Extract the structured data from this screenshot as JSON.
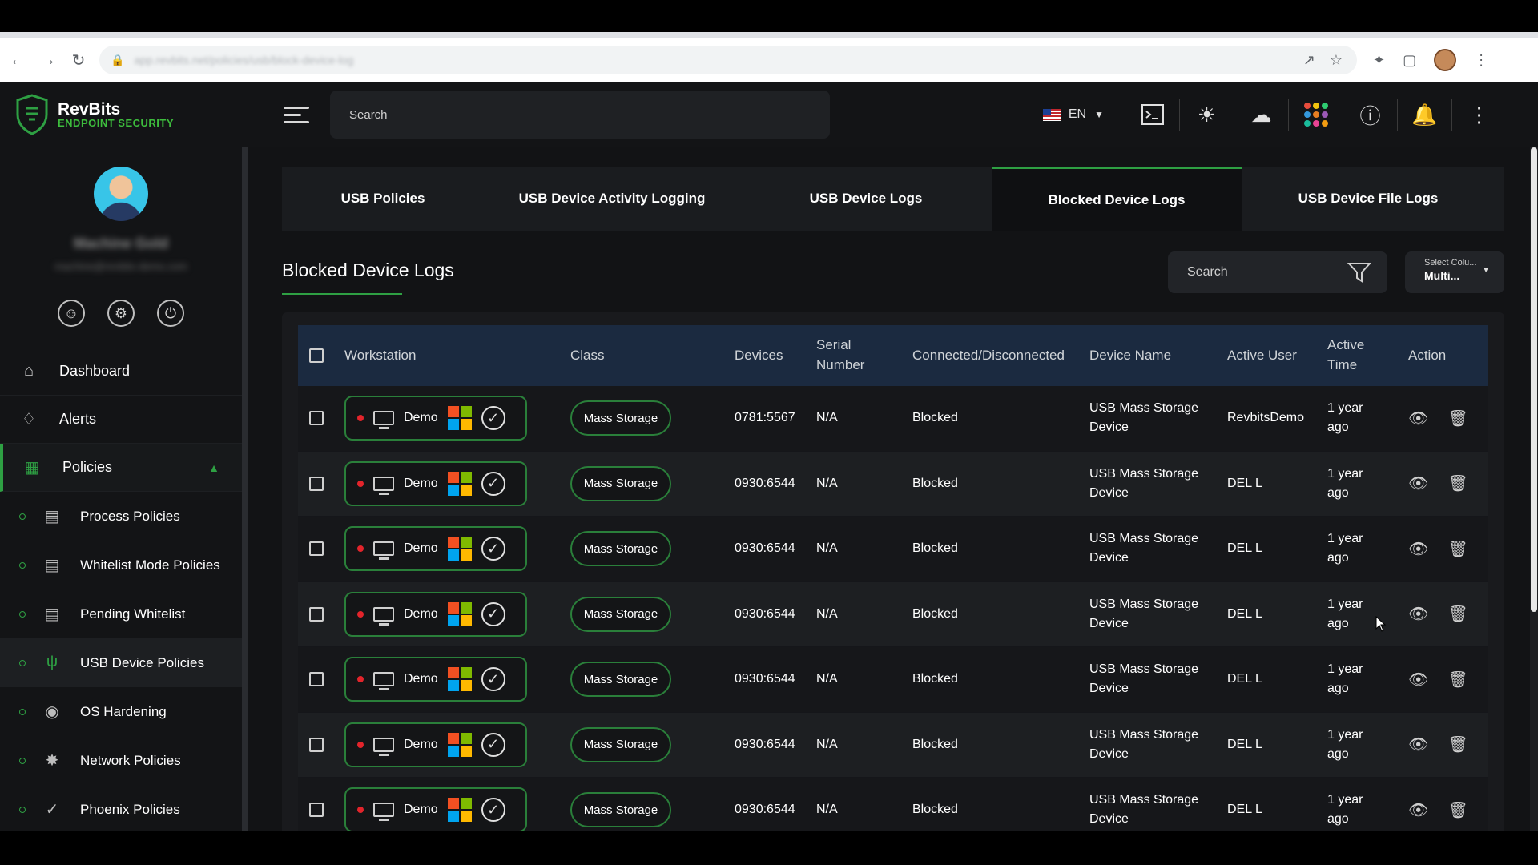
{
  "browser": {
    "url": "app.revbits.net/policies/usb/block-device-log",
    "nav": [
      "back-icon",
      "forward-icon",
      "reload-icon"
    ]
  },
  "header": {
    "brand_name": "RevBits",
    "brand_sub": "ENDPOINT SECURITY",
    "search_placeholder": "Search",
    "language": "EN",
    "accent": "#2ea043"
  },
  "profile": {
    "name": "Machine Gold",
    "email": "machine@revbits-demo.com"
  },
  "sidebar": {
    "items": [
      {
        "label": "Dashboard",
        "icon": "home-icon"
      },
      {
        "label": "Alerts",
        "icon": "bell-icon"
      },
      {
        "label": "Policies",
        "icon": "policy-icon"
      }
    ],
    "sub_items": [
      {
        "label": "Process Policies",
        "icon": "process-icon"
      },
      {
        "label": "Whitelist Mode Policies",
        "icon": "whitelist-icon"
      },
      {
        "label": "Pending Whitelist",
        "icon": "pending-icon"
      },
      {
        "label": "USB Device Policies",
        "icon": "usb-icon"
      },
      {
        "label": "OS Hardening",
        "icon": "hardening-icon"
      },
      {
        "label": "Network Policies",
        "icon": "network-icon"
      },
      {
        "label": "Phoenix Policies",
        "icon": "phoenix-icon"
      }
    ]
  },
  "tabs": [
    {
      "label": "USB Policies"
    },
    {
      "label": "USB Device Activity Logging"
    },
    {
      "label": "USB Device Logs"
    },
    {
      "label": "Blocked Device Logs"
    },
    {
      "label": "USB Device File Logs"
    }
  ],
  "main": {
    "title": "Blocked Device Logs",
    "search_placeholder": "Search",
    "column_select_label": "Select Colu...",
    "column_select_value": "Multi..."
  },
  "table": {
    "headers": {
      "workstation": "Workstation",
      "class": "Class",
      "devices": "Devices",
      "serial_1": "Serial",
      "serial_2": "Number",
      "connected": "Connected/Disconnected",
      "device_name": "Device Name",
      "active_user": "Active User",
      "active_time_1": "Active",
      "active_time_2": "Time",
      "action": "Action"
    },
    "rows": [
      {
        "workstation": "Demo",
        "class": "Mass Storage",
        "devices": "0781:5567",
        "serial": "N/A",
        "status": "Blocked",
        "name_1": "USB Mass Storage",
        "name_2": "Device",
        "user": "RevbitsDemo",
        "time_1": "1 year",
        "time_2": "ago"
      },
      {
        "workstation": "Demo",
        "class": "Mass Storage",
        "devices": "0930:6544",
        "serial": "N/A",
        "status": "Blocked",
        "name_1": "USB Mass Storage",
        "name_2": "Device",
        "user": "DEL L",
        "time_1": "1 year",
        "time_2": "ago"
      },
      {
        "workstation": "Demo",
        "class": "Mass Storage",
        "devices": "0930:6544",
        "serial": "N/A",
        "status": "Blocked",
        "name_1": "USB Mass Storage",
        "name_2": "Device",
        "user": "DEL L",
        "time_1": "1 year",
        "time_2": "ago"
      },
      {
        "workstation": "Demo",
        "class": "Mass Storage",
        "devices": "0930:6544",
        "serial": "N/A",
        "status": "Blocked",
        "name_1": "USB Mass Storage",
        "name_2": "Device",
        "user": "DEL L",
        "time_1": "1 year",
        "time_2": "ago"
      },
      {
        "workstation": "Demo",
        "class": "Mass Storage",
        "devices": "0930:6544",
        "serial": "N/A",
        "status": "Blocked",
        "name_1": "USB Mass Storage",
        "name_2": "Device",
        "user": "DEL L",
        "time_1": "1 year",
        "time_2": "ago"
      },
      {
        "workstation": "Demo",
        "class": "Mass Storage",
        "devices": "0930:6544",
        "serial": "N/A",
        "status": "Blocked",
        "name_1": "USB Mass Storage",
        "name_2": "Device",
        "user": "DEL L",
        "time_1": "1 year",
        "time_2": "ago"
      },
      {
        "workstation": "Demo",
        "class": "Mass Storage",
        "devices": "0930:6544",
        "serial": "N/A",
        "status": "Blocked",
        "name_1": "USB Mass Storage",
        "name_2": "Device",
        "user": "DEL L",
        "time_1": "1 year",
        "time_2": "ago"
      }
    ]
  }
}
